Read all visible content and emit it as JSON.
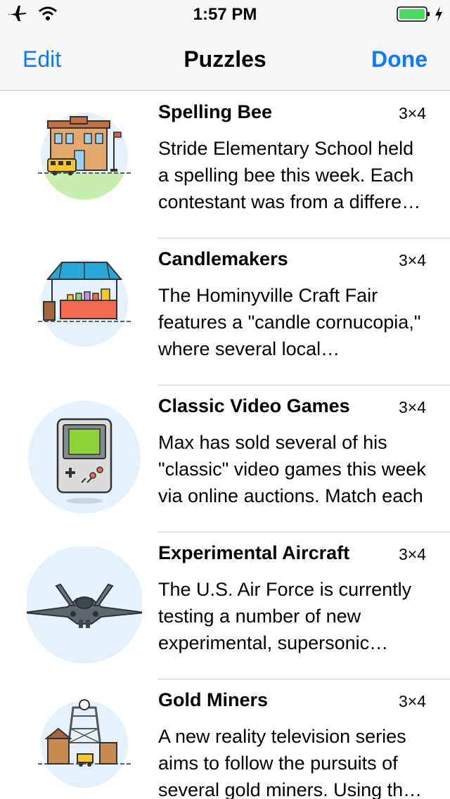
{
  "status": {
    "time": "1:57 PM"
  },
  "nav": {
    "edit_label": "Edit",
    "title": "Puzzles",
    "done_label": "Done"
  },
  "puzzles": [
    {
      "title": "Spelling Bee",
      "size": "3×4",
      "description": "Stride Elementary School held a spelling bee this week. Each contestant was from a different state",
      "icon": "school-icon"
    },
    {
      "title": "Candlemakers",
      "size": "3×4",
      "description": "The Hominyville Craft Fair features a \"candle cornucopia,\" where several local candlemakers",
      "icon": "craft-booth-icon"
    },
    {
      "title": "Classic Video Games",
      "size": "3×4",
      "description": "Max has sold several of his \"classic\" video games this week via online auctions. Match each",
      "icon": "handheld-console-icon"
    },
    {
      "title": "Experimental Aircraft",
      "size": "3×4",
      "description": "The U.S. Air Force is currently testing a number of new experimental, supersonic aircraft",
      "icon": "jet-aircraft-icon"
    },
    {
      "title": "Gold Miners",
      "size": "3×4",
      "description": "A new reality television series aims to follow the pursuits of several gold miners. Using the clues",
      "icon": "mine-tower-icon"
    }
  ],
  "colors": {
    "accent": "#0a7aff",
    "battery": "#4cd964",
    "thumb_circle": "#e5f1fb"
  }
}
